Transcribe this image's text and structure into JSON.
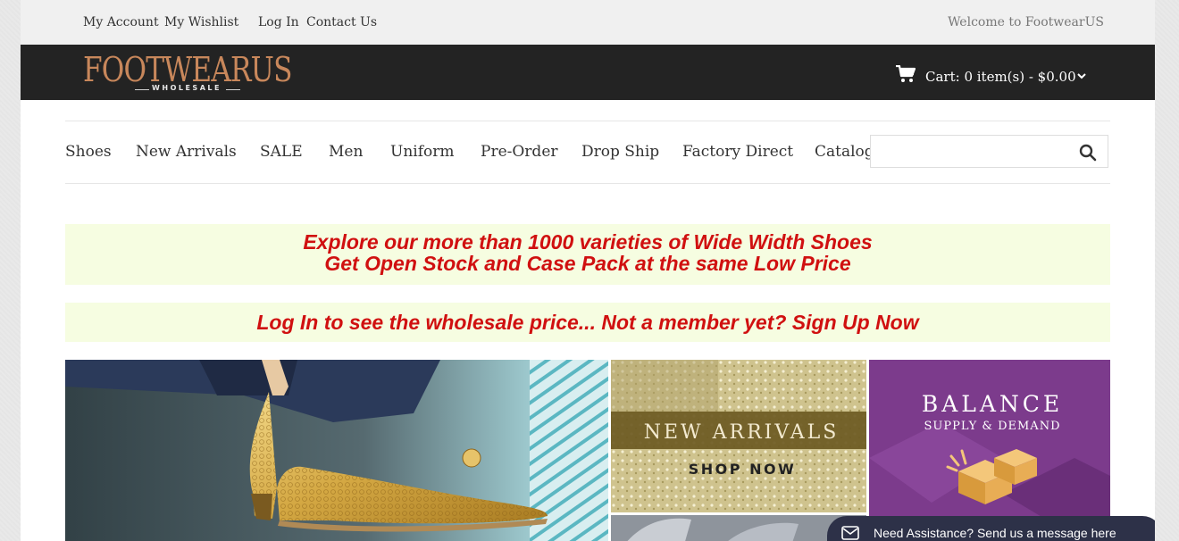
{
  "topbar": {
    "links": [
      "My Account",
      "My Wishlist",
      "Log In",
      "Contact Us"
    ],
    "welcome": "Welcome to FootwearUS"
  },
  "header": {
    "logo_main": "FOOTWEARUS",
    "logo_sub": "WHOLESALE",
    "cart_label": "Cart: 0 item(s) - $0.00",
    "colors": {
      "header_bg": "#232323",
      "logo": "#c8875b"
    }
  },
  "nav": {
    "items": [
      "Shoes",
      "New Arrivals",
      "SALE",
      "Men",
      "Uniform",
      "Pre-Order",
      "Drop Ship",
      "Factory Direct",
      "Catalog"
    ],
    "search_placeholder": ""
  },
  "promos": {
    "line1": "Explore our more than 1000 varieties of Wide Width Shoes",
    "line2": "Get Open Stock and Case Pack at the same Low Price",
    "signup": "Log In to see the wholesale price... Not a member yet? Sign Up Now",
    "color": "#d01010",
    "bg": "#f6fde1"
  },
  "banners": {
    "new_arrivals_title": "NEW ARRIVALS",
    "new_arrivals_cta": "SHOP NOW",
    "balance_title": "BALANCE",
    "balance_sub": "SUPPLY & DEMAND"
  },
  "chat": {
    "label": "Need Assistance? Send us a message here",
    "icon": "envelope-icon"
  }
}
